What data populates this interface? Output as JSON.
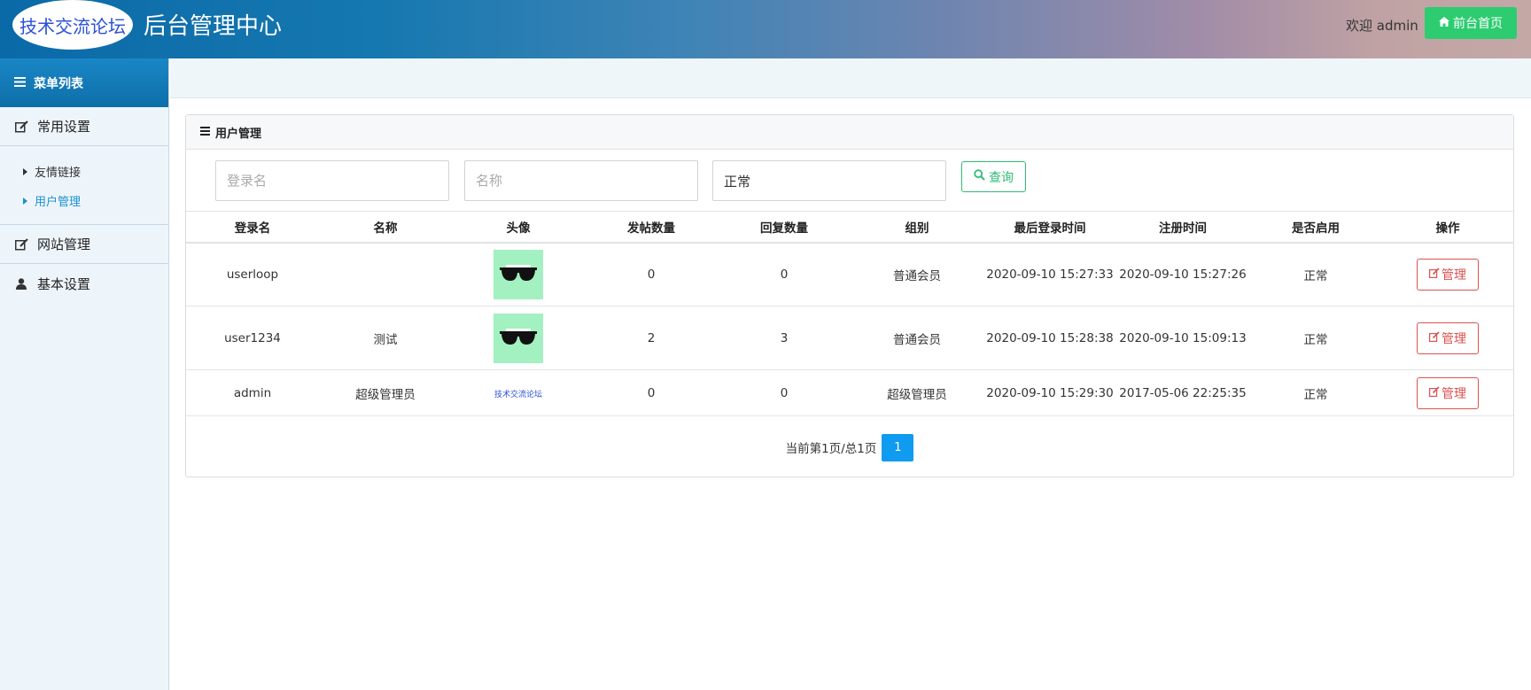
{
  "header": {
    "logo_text": "技术交流论坛",
    "title": "后台管理中心",
    "welcome": "欢迎 admin",
    "home_button": "前台首页"
  },
  "sidebar": {
    "menu_title": "菜单列表",
    "groups": [
      {
        "label": "常用设置",
        "icon": "edit-icon",
        "items": [
          {
            "label": "友情链接",
            "active": false
          },
          {
            "label": "用户管理",
            "active": true
          }
        ]
      },
      {
        "label": "网站管理",
        "icon": "edit-icon"
      },
      {
        "label": "基本设置",
        "icon": "user-icon"
      }
    ]
  },
  "panel": {
    "title": "用户管理",
    "filters": {
      "login_placeholder": "登录名",
      "name_placeholder": "名称",
      "status_value": "正常",
      "search_button": "查询"
    },
    "columns": [
      "登录名",
      "名称",
      "头像",
      "发帖数量",
      "回复数量",
      "组别",
      "最后登录时间",
      "注册时间",
      "是否启用",
      "操作"
    ],
    "rows": [
      {
        "login": "userloop",
        "name": "",
        "avatar": "sunglasses-avatar",
        "posts": "0",
        "replies": "0",
        "group": "普通会员",
        "last_login": "2020-09-10 15:27:33",
        "registered": "2020-09-10 15:27:26",
        "enabled": "正常",
        "action": "管理"
      },
      {
        "login": "user1234",
        "name": "测试",
        "avatar": "sunglasses-avatar",
        "posts": "2",
        "replies": "3",
        "group": "普通会员",
        "last_login": "2020-09-10 15:28:38",
        "registered": "2020-09-10 15:09:13",
        "enabled": "正常",
        "action": "管理"
      },
      {
        "login": "admin",
        "name": "超级管理员",
        "avatar_text": "技术交流论坛",
        "posts": "0",
        "replies": "0",
        "group": "超级管理员",
        "last_login": "2020-09-10 15:29:30",
        "registered": "2017-05-06 22:25:35",
        "enabled": "正常",
        "action": "管理"
      }
    ],
    "pager": {
      "info": "当前第1页/总1页",
      "current": "1"
    }
  },
  "colors": {
    "accent": "#1a86c6",
    "success": "#2ecc71",
    "danger": "#d9534f",
    "page_active": "#0e9bf0"
  }
}
